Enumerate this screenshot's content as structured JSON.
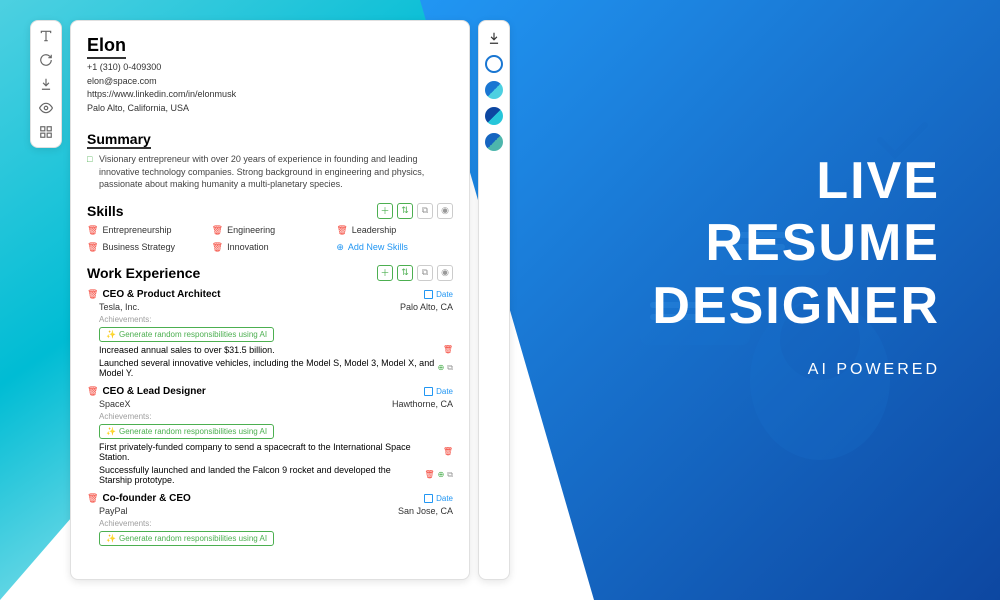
{
  "hero": {
    "line1": "LIVE",
    "line2": "RESUME",
    "line3": "DESIGNER",
    "subtitle": "AI POWERED"
  },
  "resume": {
    "name": "Elon",
    "phone": "+1 (310) 0-409300",
    "email": "elon@space.com",
    "linkedin": "https://www.linkedin.com/in/elonmusk",
    "location": "Palo Alto, California, USA",
    "summary_title": "Summary",
    "summary_body": "Visionary entrepreneur with over 20 years of experience in founding and leading innovative technology companies. Strong background in engineering and physics, passionate about making humanity a multi-planetary species.",
    "skills_title": "Skills",
    "skills": [
      "Entrepreneurship",
      "Engineering",
      "Leadership",
      "Business Strategy",
      "Innovation"
    ],
    "add_skills_label": "Add New Skills",
    "work_title": "Work Experience",
    "ai_btn_label": "Generate random responsibilities using AI",
    "date_label": "Date",
    "ach_label": "Achievements:",
    "jobs": [
      {
        "title": "CEO & Product Architect",
        "company": "Tesla, Inc.",
        "location": "Palo Alto, CA",
        "achievements": [
          "Increased annual sales to over $31.5 billion.",
          "Launched several innovative vehicles, including the Model S, Model 3, Model X, and Model Y."
        ]
      },
      {
        "title": "CEO & Lead Designer",
        "company": "SpaceX",
        "location": "Hawthorne, CA",
        "achievements": [
          "First privately-funded company to send a spacecraft to the International Space Station.",
          "Successfully launched and landed the Falcon 9 rocket and developed the Starship prototype."
        ]
      },
      {
        "title": "Co-founder & CEO",
        "company": "PayPal",
        "location": "San Jose, CA",
        "achievements": []
      }
    ]
  }
}
